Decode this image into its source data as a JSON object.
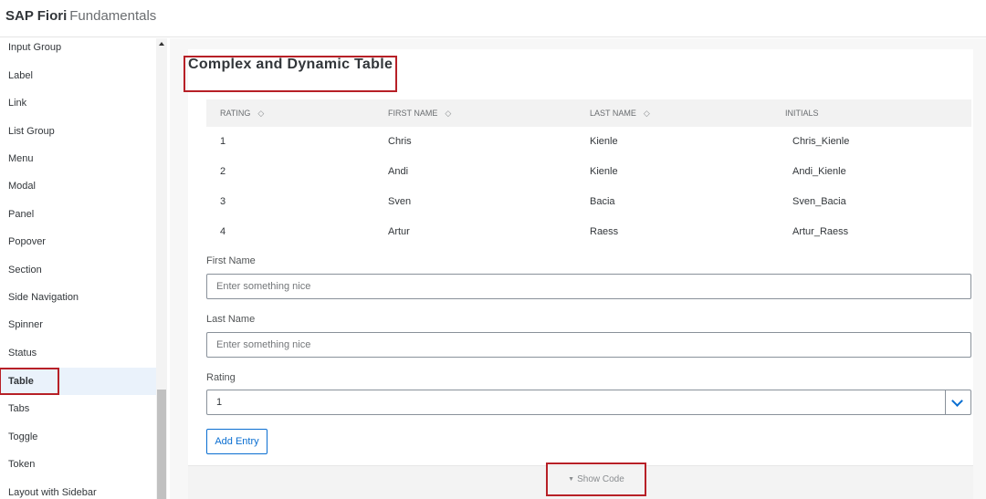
{
  "header": {
    "brand_bold": "SAP Fiori",
    "brand_light": "Fundamentals"
  },
  "sidebar": {
    "items": [
      {
        "label": "Input Group"
      },
      {
        "label": "Label"
      },
      {
        "label": "Link"
      },
      {
        "label": "List Group"
      },
      {
        "label": "Menu"
      },
      {
        "label": "Modal"
      },
      {
        "label": "Panel"
      },
      {
        "label": "Popover"
      },
      {
        "label": "Section"
      },
      {
        "label": "Side Navigation"
      },
      {
        "label": "Spinner"
      },
      {
        "label": "Status"
      },
      {
        "label": "Table",
        "active": true
      },
      {
        "label": "Tabs"
      },
      {
        "label": "Toggle"
      },
      {
        "label": "Token"
      },
      {
        "label": "Layout with Sidebar"
      }
    ],
    "scrollbar_icons": [
      "scroll-up-arrow-icon"
    ]
  },
  "panel": {
    "title": "Complex and Dynamic Table",
    "table": {
      "columns": [
        {
          "label": "RATING",
          "sortable": true
        },
        {
          "label": "FIRST NAME",
          "sortable": true
        },
        {
          "label": "LAST NAME",
          "sortable": true
        },
        {
          "label": "INITIALS",
          "sortable": false
        }
      ],
      "sort_icon": "◇",
      "rows": [
        [
          "1",
          "Chris",
          "Kienle",
          "Chris_Kienle"
        ],
        [
          "2",
          "Andi",
          "Kienle",
          "Andi_Kienle"
        ],
        [
          "3",
          "Sven",
          "Bacia",
          "Sven_Bacia"
        ],
        [
          "4",
          "Artur",
          "Raess",
          "Artur_Raess"
        ]
      ]
    },
    "form": {
      "first_name_label": "First Name",
      "first_name_placeholder": "Enter something nice",
      "first_name_value": "",
      "last_name_label": "Last Name",
      "last_name_placeholder": "Enter something nice",
      "last_name_value": "",
      "rating_label": "Rating",
      "rating_value": "1",
      "add_button": "Add Entry"
    },
    "show_code": {
      "caret": "▼",
      "label": "Show Code"
    }
  },
  "colors": {
    "accent": "#0a6ed1",
    "highlight_box": "#b72027",
    "active_nav_bg": "#eaf2fb",
    "table_header_bg": "#f2f2f2",
    "page_bg": "#f7f7f7",
    "text": "#32363a"
  }
}
